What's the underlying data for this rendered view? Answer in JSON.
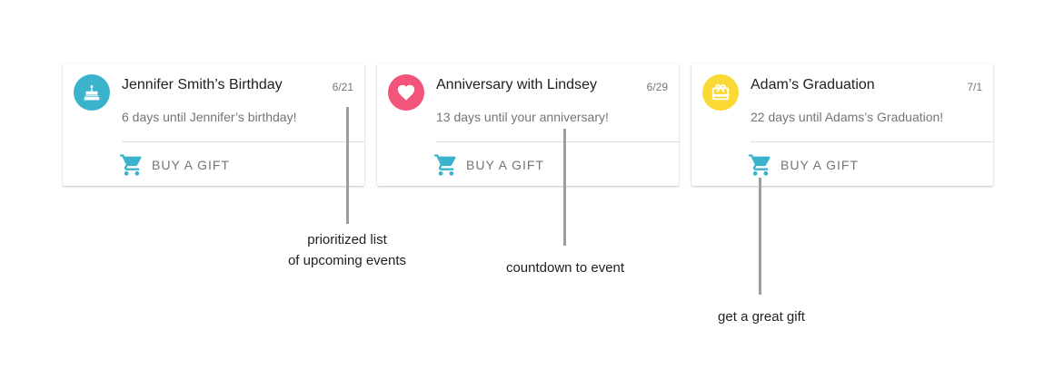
{
  "colors": {
    "accent": "#3bb3cc",
    "birthday": "#3bb3cc",
    "anniversary": "#f2547a",
    "graduation": "#fbd934"
  },
  "events": [
    {
      "icon": "birthday-cake-icon",
      "title": "Jennifer Smith’s Birthday",
      "date": "6/21",
      "subtitle": "6 days until Jennifer’s birthday!",
      "action_label": "BUY A GIFT"
    },
    {
      "icon": "heart-icon",
      "title": "Anniversary with Lindsey",
      "date": "6/29",
      "subtitle": "13 days until your anniversary!",
      "action_label": "BUY A GIFT"
    },
    {
      "icon": "gift-icon",
      "title": "Adam’s Graduation",
      "date": "7/1",
      "subtitle": "22 days until Adams’s Graduation!",
      "action_label": "BUY A GIFT"
    }
  ],
  "annotations": [
    {
      "text_line1": "prioritized list",
      "text_line2": "of upcoming events"
    },
    {
      "text_line1": "countdown to event"
    },
    {
      "text_line1": "get a great gift"
    }
  ]
}
